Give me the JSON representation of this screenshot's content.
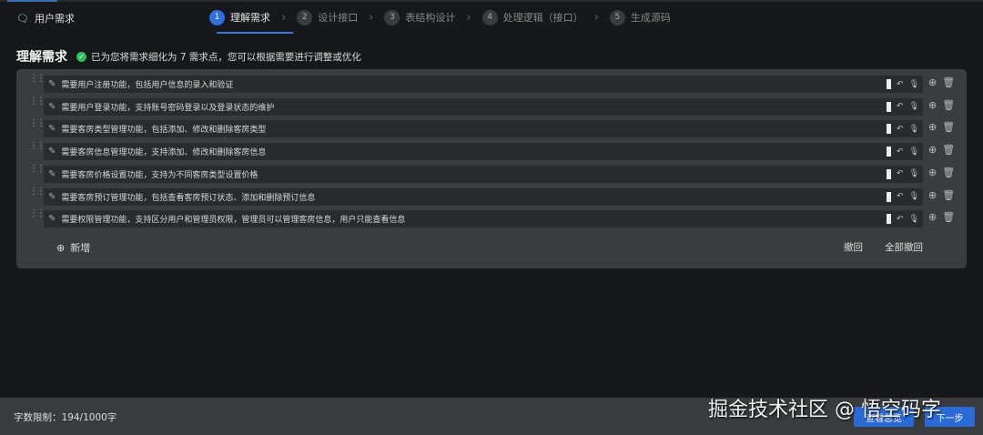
{
  "header": {
    "title": "用户需求",
    "steps": [
      {
        "n": "1",
        "label": "理解需求"
      },
      {
        "n": "2",
        "label": "设计接口"
      },
      {
        "n": "3",
        "label": "表结构设计"
      },
      {
        "n": "4",
        "label": "处理逻辑（接口）"
      },
      {
        "n": "5",
        "label": "生成源码"
      }
    ]
  },
  "section": {
    "title": "理解需求",
    "message": "已为您将需求细化为 7 需求点，您可以根据需要进行调整或优化"
  },
  "requirements": [
    "需要用户注册功能，包括用户信息的录入和验证",
    "需要用户登录功能，支持账号密码登录以及登录状态的维护",
    "需要客房类型管理功能，包括添加、修改和删除客房类型",
    "需要客房信息管理功能，支持添加、修改和删除客房信息",
    "需要客房价格设置功能，支持为不同客房类型设置价格",
    "需要客房预订管理功能，包括查看客房预订状态、添加和删除预订信息",
    "需要权限管理功能，支持区分用户和管理员权限，管理员可以管理客房信息，用户只能查看信息"
  ],
  "actions": {
    "add": "新增",
    "undo": "撤回",
    "undo_all": "全部撤回"
  },
  "footer": {
    "limit": "字数限制：194/1000字",
    "overview": "查看总览",
    "next": "下一步"
  },
  "watermark": "掘金技术社区 @ 悟空码字"
}
